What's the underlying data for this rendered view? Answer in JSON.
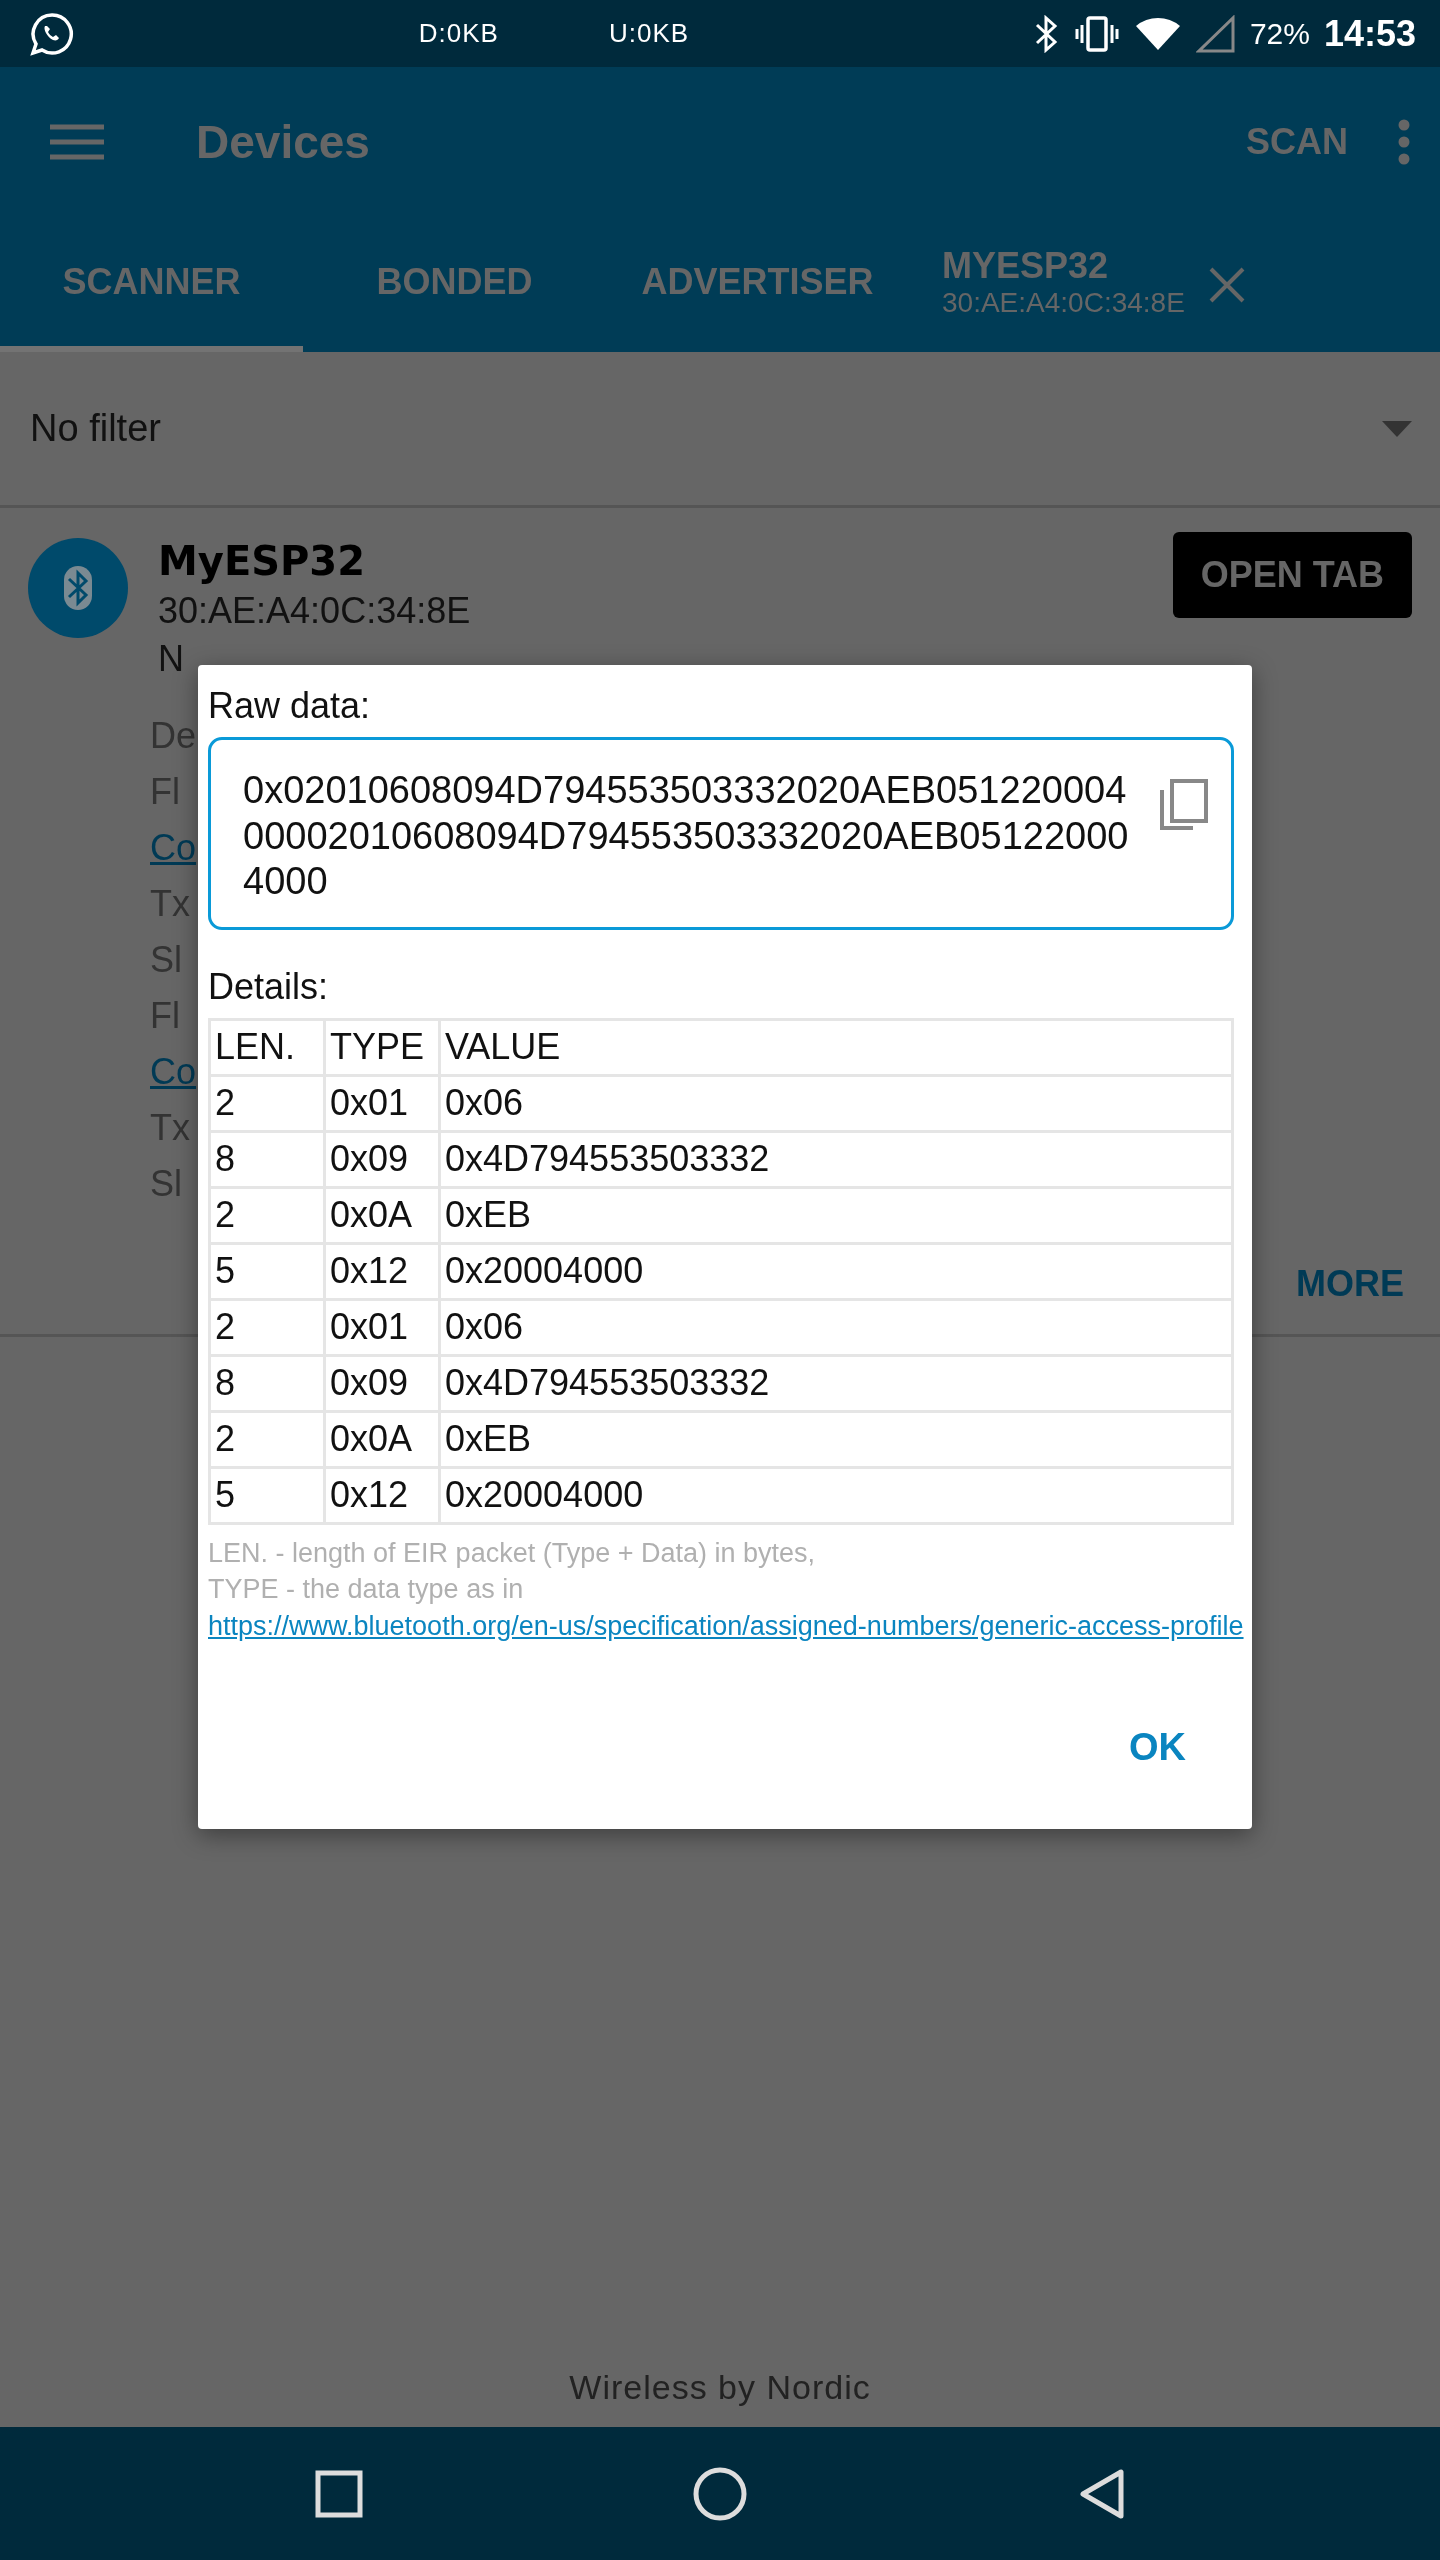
{
  "status_bar": {
    "download": "D:0KB",
    "upload": "U:0KB",
    "battery": "72%",
    "time": "14:53"
  },
  "app_bar": {
    "title": "Devices",
    "action": "SCAN"
  },
  "tabs": [
    {
      "label": "SCANNER",
      "kind": "plain",
      "selected": true
    },
    {
      "label": "BONDED",
      "kind": "plain",
      "selected": false
    },
    {
      "label": "ADVERTISER",
      "kind": "plain",
      "selected": false
    },
    {
      "label": "MYESP32",
      "subtitle": "30:AE:A4:0C:34:8E",
      "kind": "device",
      "selected": false
    }
  ],
  "filter": {
    "value": "No filter"
  },
  "device": {
    "name": "MyESP32",
    "address": "30:AE:A4:0C:34:8E",
    "bond_state": "N",
    "open_button": "OPEN TAB",
    "details": [
      {
        "text": "De",
        "kind": "plain"
      },
      {
        "text": "Fl",
        "kind": "plain"
      },
      {
        "text": "Co",
        "kind": "link"
      },
      {
        "text": "Tx",
        "kind": "plain"
      },
      {
        "text": "Sl",
        "kind": "plain"
      },
      {
        "text": "Fl",
        "kind": "plain"
      },
      {
        "text": "Co",
        "kind": "link"
      },
      {
        "text": "Tx",
        "kind": "plain"
      },
      {
        "text": "Sl",
        "kind": "plain"
      }
    ],
    "more_button": "MORE"
  },
  "dialog": {
    "raw_label": "Raw data:",
    "raw_value": "0x02010608094D794553503332020AEB05122000400002010608094D794553503332020AEB051220004000",
    "details_label": "Details:",
    "columns": [
      "LEN.",
      "TYPE",
      "VALUE"
    ],
    "rows": [
      [
        "2",
        "0x01",
        "0x06"
      ],
      [
        "8",
        "0x09",
        "0x4D794553503332"
      ],
      [
        "2",
        "0x0A",
        "0xEB"
      ],
      [
        "5",
        "0x12",
        "0x20004000"
      ],
      [
        "2",
        "0x01",
        "0x06"
      ],
      [
        "8",
        "0x09",
        "0x4D794553503332"
      ],
      [
        "2",
        "0x0A",
        "0xEB"
      ],
      [
        "5",
        "0x12",
        "0x20004000"
      ]
    ],
    "footnote_lines": [
      "LEN. - length of EIR packet (Type + Data) in bytes,",
      "TYPE - the data type as in"
    ],
    "link": "https://www.bluetooth.org/en-us/specification/assigned-numbers/generic-access-profile",
    "ok_button": "OK"
  },
  "footer": "Wireless by Nordic"
}
